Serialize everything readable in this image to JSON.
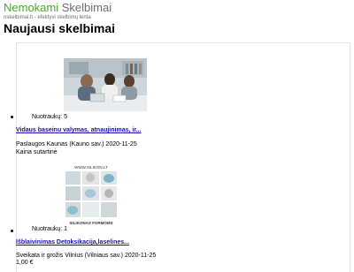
{
  "site": {
    "logo_word1": "Nemokami",
    "logo_word2": "Skelbimai",
    "tagline": "nskelbimai.lt - efektyvi skelbimų lenta",
    "colors": {
      "green": "#4aa82e",
      "gray": "#6d6d6d",
      "link": "#1a0dab"
    }
  },
  "page": {
    "heading": "Naujausi skelbimai"
  },
  "listings": [
    {
      "photo_count": "Nuotraukų: 5",
      "title": "Vidaus baseinu valymas, atnaujinimas, ir...",
      "meta": "Paslaugos Kaunas (Kauno sav.) 2020-11-25",
      "price": "Kaina sutartinė",
      "image": "people-at-desk-photo"
    },
    {
      "photo_count": "Nuotraukų: 1",
      "title": "Išblaivinimas Detoksikacija,laselines...",
      "meta": "Sveikata ir grožis Vilnius (Vilniaus sav.) 2020-11-25",
      "price": "1,00 €",
      "image_text": "WWW.SILIKON.LT",
      "image_caption": "SILIKONAS FORMOMS"
    }
  ]
}
